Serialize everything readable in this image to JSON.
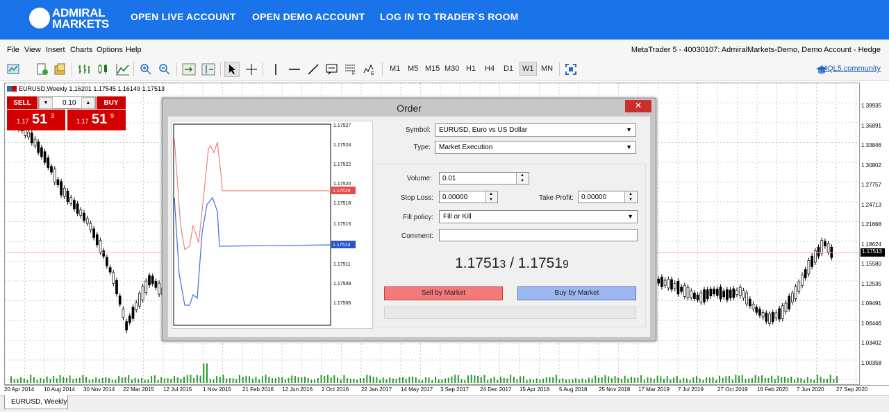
{
  "header": {
    "logo_line1": "ADMIRAL",
    "logo_line2": "MARKETS",
    "links": [
      "OPEN LIVE ACCOUNT",
      "OPEN DEMO ACCOUNT",
      "LOG IN TO TRADER`S ROOM"
    ]
  },
  "menu": {
    "items": [
      "File",
      "View",
      "Insert",
      "Charts",
      "Options",
      "Help"
    ],
    "account_info": "MetaTrader 5 - 40030107: AdmiralMarkets-Demo, Demo Account - Hedge"
  },
  "toolbar": {
    "timeframes": [
      "M1",
      "M5",
      "M15",
      "M30",
      "H1",
      "H4",
      "D1",
      "W1",
      "MN"
    ],
    "selected_timeframe": "W1",
    "mql_link": "MQL5.community"
  },
  "chart": {
    "symbol_line": "EURUSD,Weekly  1.16201 1.17545 1.16149 1.17513",
    "y_ticks": [
      "1.39935",
      "1.36891",
      "1.33846",
      "1.30802",
      "1.27757",
      "1.24713",
      "1.21668",
      "1.18624",
      "1.15580",
      "1.12535",
      "1.09491",
      "1.06446",
      "1.03402",
      "1.00358"
    ],
    "current_price": "1.17513",
    "x_ticks": [
      "20 Apr 2014",
      "10 Aug 2014",
      "30 Nov 2014",
      "22 Mar 2015",
      "12 Jul 2015",
      "1 Nov 2015",
      "21 Feb 2016",
      "12 Jun 2016",
      "2 Oct 2016",
      "22 Jan 2017",
      "14 May 2017",
      "3 Sep 2017",
      "24 Dec 2017",
      "15 Apr 2018",
      "5 Aug 2018",
      "25 Nov 2018",
      "17 Mar 2019",
      "7 Jul 2019",
      "27 Oct 2019",
      "16 Feb 2020",
      "7 Jun 2020",
      "27 Sep 2020"
    ],
    "tab": "EURUSD, Weekly"
  },
  "one_click": {
    "sell_label": "SELL",
    "buy_label": "BUY",
    "volume": "0.10",
    "sell_prefix": "1.17",
    "sell_big": "51",
    "sell_small": "3",
    "buy_prefix": "1.17",
    "buy_big": "51",
    "buy_small": "9"
  },
  "order": {
    "title": "Order",
    "close": "✕",
    "symbol_label": "Symbol:",
    "symbol_value": "EURUSD, Euro vs US Dollar",
    "type_label": "Type:",
    "type_value": "Market Execution",
    "volume_label": "Volume:",
    "volume_value": "0.01",
    "sl_label": "Stop Loss:",
    "sl_value": "0.00000",
    "tp_label": "Take Profit:",
    "tp_value": "0.00000",
    "fill_label": "Fill policy:",
    "fill_value": "Fill or Kill",
    "comment_label": "Comment:",
    "comment_value": "",
    "quote_main": "1.1751",
    "quote_bid_sup": "3",
    "quote_sep": " / ",
    "quote_ask_main": "1.1751",
    "quote_ask_sup": "9",
    "sell_btn": "Sell by Market",
    "buy_btn": "Buy by Market",
    "tick_labels": [
      "1.17527",
      "1.17524",
      "1.17522",
      "1.17520",
      "1.17518",
      "1.17515",
      "1.17513",
      "1.17511",
      "1.17509",
      "1.17506"
    ],
    "ask_tag": "1.17519",
    "bid_tag": "1.17513"
  },
  "colors": {
    "brand": "#1a73e8",
    "sell": "#d40000",
    "ask_line": "#f08080",
    "bid_line": "#3a6fd8"
  }
}
